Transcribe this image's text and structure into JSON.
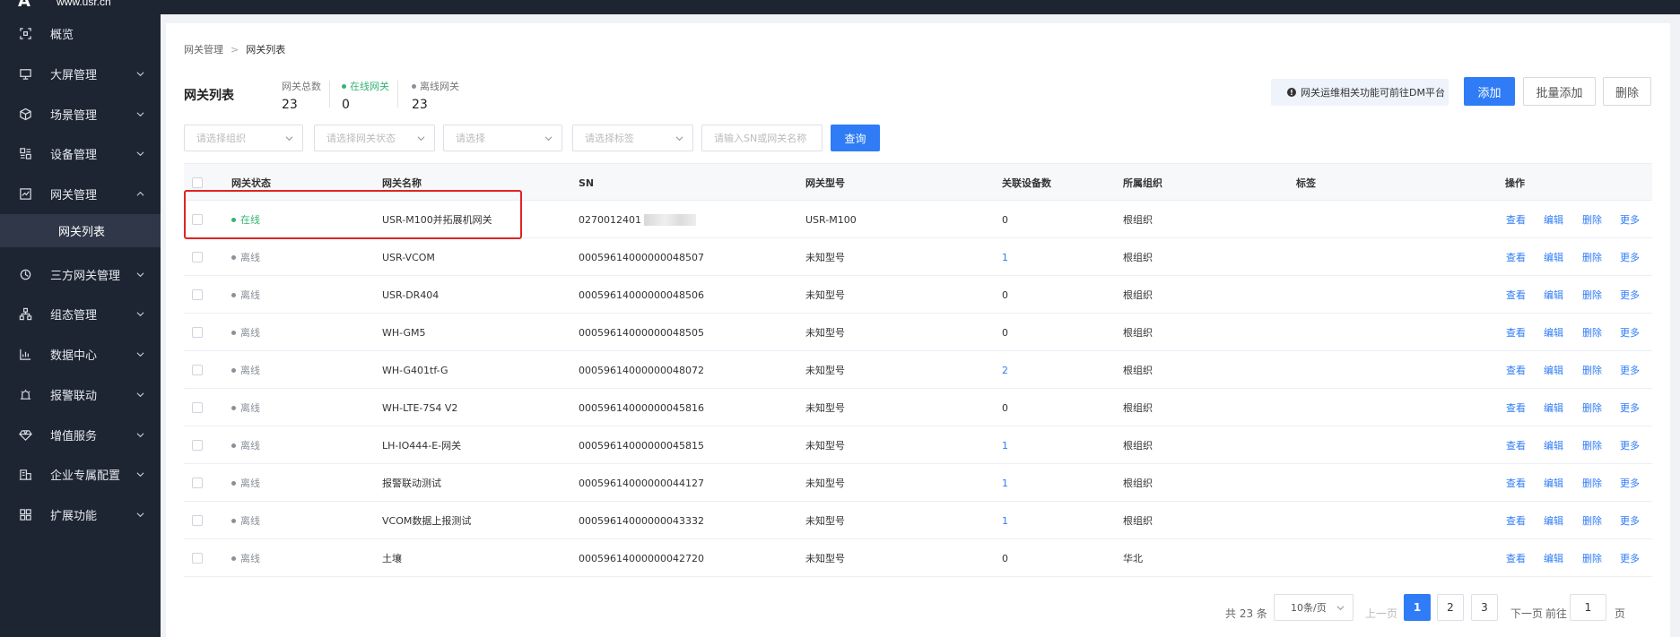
{
  "brand": {
    "mark": "A",
    "url": "www.usr.cn"
  },
  "sidebar": {
    "items": [
      {
        "label": "概览",
        "icon": "scan-icon",
        "has_children": false
      },
      {
        "label": "大屏管理",
        "icon": "monitor-icon",
        "has_children": true
      },
      {
        "label": "场景管理",
        "icon": "cube-icon",
        "has_children": true
      },
      {
        "label": "设备管理",
        "icon": "device-grid-icon",
        "has_children": true
      },
      {
        "label": "网关管理",
        "icon": "gateway-icon",
        "has_children": true,
        "expanded": true
      },
      {
        "label": "三方网关管理",
        "icon": "cluster-icon",
        "has_children": true
      },
      {
        "label": "组态管理",
        "icon": "hierarchy-icon",
        "has_children": true
      },
      {
        "label": "数据中心",
        "icon": "bar-chart-icon",
        "has_children": true
      },
      {
        "label": "报警联动",
        "icon": "alarm-icon",
        "has_children": true
      },
      {
        "label": "增值服务",
        "icon": "diamond-icon",
        "has_children": true
      },
      {
        "label": "企业专属配置",
        "icon": "building-icon",
        "has_children": true
      },
      {
        "label": "扩展功能",
        "icon": "apps-icon",
        "has_children": true
      }
    ],
    "active_sub": "网关列表"
  },
  "breadcrumb": {
    "parent": "网关管理",
    "current": "网关列表"
  },
  "page": {
    "title": "网关列表"
  },
  "stats": {
    "total": {
      "label": "网关总数",
      "value": "23"
    },
    "online": {
      "label": "在线网关",
      "value": "0",
      "color": "#35b374"
    },
    "offline": {
      "label": "离线网关",
      "value": "23",
      "color": "#8a8f99"
    }
  },
  "notice": {
    "text": "网关运维相关功能可前往DM平台"
  },
  "actions": {
    "add": "添加",
    "batch_add": "批量添加",
    "delete": "删除"
  },
  "filters": {
    "org": "请选择组织",
    "status": "请选择网关状态",
    "type": "请选择",
    "tag": "请选择标签",
    "keyword": "请输入SN或网关名称",
    "search": "查询"
  },
  "table": {
    "columns": [
      "网关状态",
      "网关名称",
      "SN",
      "网关型号",
      "关联设备数",
      "所属组织",
      "标签",
      "操作"
    ],
    "ops": [
      "查看",
      "编辑",
      "删除",
      "更多"
    ],
    "rows": [
      {
        "status": "在线",
        "online": true,
        "name": "USR-M100并拓展机网关",
        "sn": "0270012401",
        "sn_masked": true,
        "model": "USR-M100",
        "devices": "0",
        "devices_link": false,
        "org": "根组织",
        "tag": ""
      },
      {
        "status": "离线",
        "online": false,
        "name": "USR-VCOM",
        "sn": "00059614000000048507",
        "sn_masked": false,
        "model": "未知型号",
        "devices": "1",
        "devices_link": true,
        "org": "根组织",
        "tag": ""
      },
      {
        "status": "离线",
        "online": false,
        "name": "USR-DR404",
        "sn": "00059614000000048506",
        "sn_masked": false,
        "model": "未知型号",
        "devices": "0",
        "devices_link": false,
        "org": "根组织",
        "tag": ""
      },
      {
        "status": "离线",
        "online": false,
        "name": "WH-GM5",
        "sn": "00059614000000048505",
        "sn_masked": false,
        "model": "未知型号",
        "devices": "0",
        "devices_link": false,
        "org": "根组织",
        "tag": ""
      },
      {
        "status": "离线",
        "online": false,
        "name": "WH-G401tf-G",
        "sn": "00059614000000048072",
        "sn_masked": false,
        "model": "未知型号",
        "devices": "2",
        "devices_link": true,
        "org": "根组织",
        "tag": ""
      },
      {
        "status": "离线",
        "online": false,
        "name": "WH-LTE-7S4 V2",
        "sn": "00059614000000045816",
        "sn_masked": false,
        "model": "未知型号",
        "devices": "0",
        "devices_link": false,
        "org": "根组织",
        "tag": ""
      },
      {
        "status": "离线",
        "online": false,
        "name": "LH-IO444-E-网关",
        "sn": "00059614000000045815",
        "sn_masked": false,
        "model": "未知型号",
        "devices": "1",
        "devices_link": true,
        "org": "根组织",
        "tag": ""
      },
      {
        "status": "离线",
        "online": false,
        "name": "报警联动测试",
        "sn": "00059614000000044127",
        "sn_masked": false,
        "model": "未知型号",
        "devices": "1",
        "devices_link": true,
        "org": "根组织",
        "tag": ""
      },
      {
        "status": "离线",
        "online": false,
        "name": "VCOM数据上报测试",
        "sn": "00059614000000043332",
        "sn_masked": false,
        "model": "未知型号",
        "devices": "1",
        "devices_link": true,
        "org": "根组织",
        "tag": ""
      },
      {
        "status": "离线",
        "online": false,
        "name": "土壤",
        "sn": "00059614000000042720",
        "sn_masked": false,
        "model": "未知型号",
        "devices": "0",
        "devices_link": false,
        "org": "华北",
        "tag": ""
      }
    ]
  },
  "pagination": {
    "total_text": "共 23 条",
    "page_size": "10条/页",
    "prev": "上一页",
    "pages": [
      "1",
      "2",
      "3"
    ],
    "current": "1",
    "next": "下一页",
    "goto_prefix": "前往",
    "goto_value": "1",
    "goto_suffix": "页"
  },
  "colors": {
    "primary": "#2f7cf6",
    "sidebar_bg": "#1e2532",
    "online": "#35b374",
    "highlight": "#e02424"
  }
}
